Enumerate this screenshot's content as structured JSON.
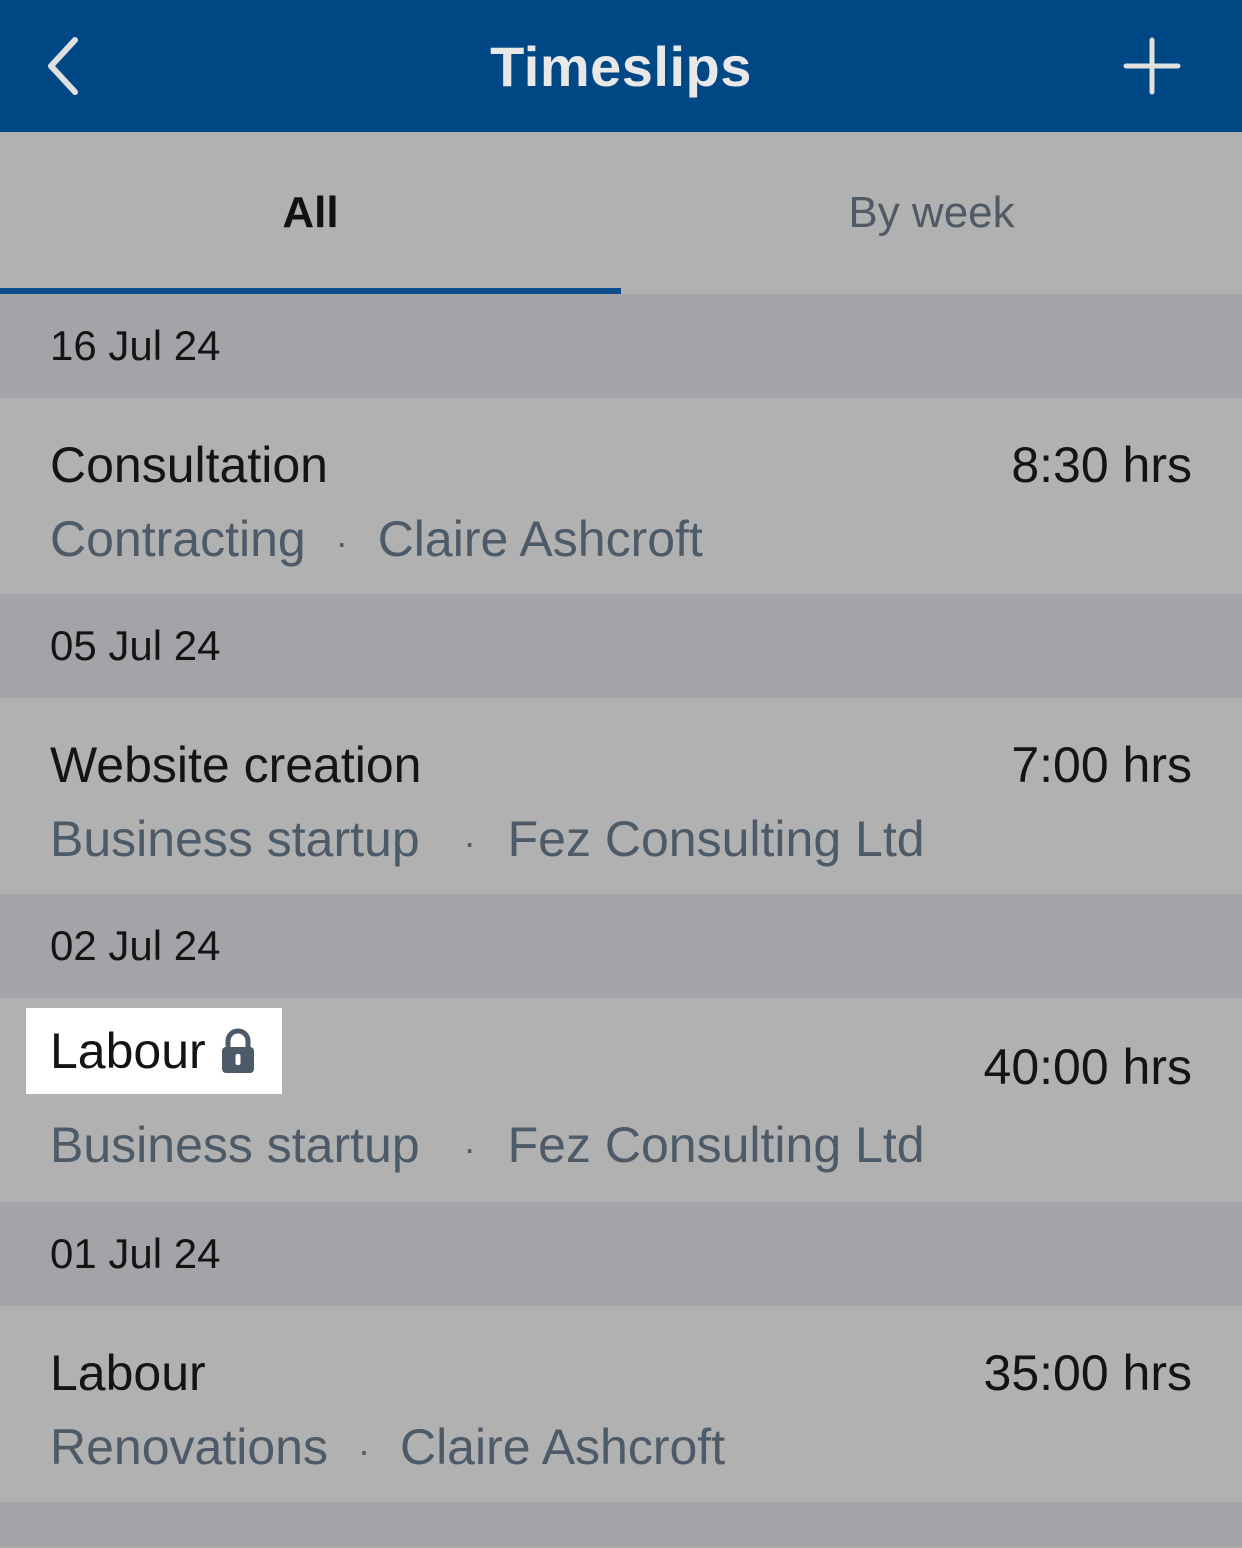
{
  "header": {
    "title": "Timeslips"
  },
  "tabs": [
    {
      "label": "All",
      "active": true
    },
    {
      "label": "By week",
      "active": false
    }
  ],
  "groups": [
    {
      "date": "16 Jul 24",
      "entry": {
        "name": "Consultation",
        "hours": "8:30 hrs",
        "project": "Contracting",
        "client": "Claire Ashcroft",
        "locked": false
      }
    },
    {
      "date": "05 Jul 24",
      "entry": {
        "name": "Website creation",
        "hours": "7:00 hrs",
        "project": "Business startup",
        "client": "Fez Consulting Ltd",
        "locked": false
      }
    },
    {
      "date": "02 Jul 24",
      "entry": {
        "name": "Labour",
        "hours": "40:00 hrs",
        "project": "Business startup",
        "client": "Fez Consulting Ltd",
        "locked": true
      }
    },
    {
      "date": "01 Jul 24",
      "entry": {
        "name": "Labour",
        "hours": "35:00 hrs",
        "project": "Renovations",
        "client": "Claire Ashcroft",
        "locked": false
      }
    }
  ],
  "separator": "·",
  "colors": {
    "header_bg": "#004885",
    "tab_indicator": "#0d4c8a",
    "secondary_text": "#4d5a68"
  }
}
